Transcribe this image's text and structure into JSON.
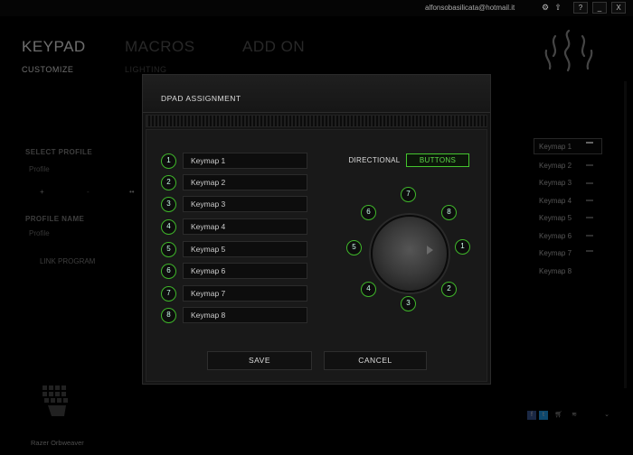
{
  "window": {
    "account_email": "alfonsobasilicata@hotmail.it",
    "icons": [
      "gear-icon",
      "upload-icon"
    ],
    "controls": [
      "?",
      "_",
      "X"
    ]
  },
  "nav": {
    "tabs": [
      "KEYPAD",
      "MACROS",
      "ADD ON"
    ],
    "subtabs": [
      "CUSTOMIZE",
      "LIGHTING"
    ]
  },
  "left_panel": {
    "select_profile_label": "SELECT PROFILE",
    "profile_value": "Profile",
    "profile_name_label": "PROFILE NAME",
    "profile_name_value": "Profile",
    "link_program_label": "LINK PROGRAM"
  },
  "right_panel": {
    "keymaps": [
      "Keymap 1",
      "Keymap 2",
      "Keymap 3",
      "Keymap 4",
      "Keymap 5",
      "Keymap 6",
      "Keymap 7",
      "Keymap 8"
    ],
    "selected_index": 0
  },
  "dialog": {
    "title": "DPAD ASSIGNMENT",
    "rows": [
      {
        "number": "1",
        "value": "Keymap 1"
      },
      {
        "number": "2",
        "value": "Keymap 2"
      },
      {
        "number": "3",
        "value": "Keymap 3"
      },
      {
        "number": "4",
        "value": "Keymap 4"
      },
      {
        "number": "5",
        "value": "Keymap 5"
      },
      {
        "number": "6",
        "value": "Keymap 6"
      },
      {
        "number": "7",
        "value": "Keymap 7"
      },
      {
        "number": "8",
        "value": "Keymap 8"
      }
    ],
    "toggle": {
      "directional": "DIRECTIONAL",
      "buttons": "BUTTONS",
      "active": "buttons"
    },
    "dpad_positions": [
      "7",
      "8",
      "1",
      "2",
      "3",
      "4",
      "5",
      "6"
    ],
    "save_label": "SAVE",
    "cancel_label": "CANCEL"
  },
  "footer": {
    "device_name": "Razer Orbweaver",
    "social_icons": [
      "facebook-icon",
      "twitter-icon",
      "cart-icon",
      "razer-icon"
    ]
  },
  "colors": {
    "accent": "#44c52e",
    "background": "#000000",
    "dialog_bg": "#191919"
  }
}
